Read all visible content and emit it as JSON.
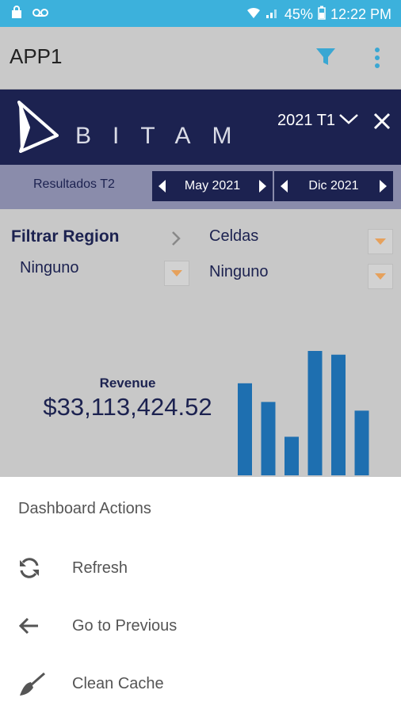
{
  "status_bar": {
    "battery": "45%",
    "time": "12:22 PM"
  },
  "app_bar": {
    "title": "APP1"
  },
  "dashboard": {
    "brand": "BITAM",
    "period": "2021 T1",
    "results_label": "Resultados T2",
    "start_period": "May 2021",
    "end_period": "Dic 2021",
    "filter_region_label": "Filtrar Region",
    "filter_region_value": "Ninguno",
    "celdas_label": "Celdas",
    "celdas_value": "Ninguno",
    "revenue_label": "Revenue",
    "revenue_value": "$33,113,424.52",
    "accent_color": "#1c2250",
    "bar_color": "#1e6fb0"
  },
  "chart_data": {
    "type": "bar",
    "values": [
      0.74,
      0.59,
      0.31,
      1.0,
      0.97,
      0.52
    ],
    "ylim": [
      0,
      1
    ]
  },
  "sheet": {
    "title": "Dashboard Actions",
    "actions": [
      {
        "label": "Refresh",
        "icon": "refresh-icon"
      },
      {
        "label": "Go to Previous",
        "icon": "arrow-left-icon"
      },
      {
        "label": "Clean Cache",
        "icon": "broom-icon"
      }
    ]
  }
}
